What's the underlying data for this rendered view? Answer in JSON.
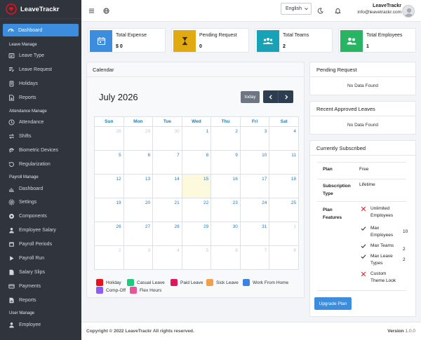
{
  "app": {
    "name": "LeaveTrackr"
  },
  "sidebar": {
    "active": {
      "label": "Dashboard",
      "icon": "dashboard-icon"
    },
    "sections": [
      {
        "title": "Leave Manage",
        "items": [
          {
            "label": "Leave Type",
            "icon": "leave-type-icon"
          },
          {
            "label": "Leave Request",
            "icon": "leave-request-icon"
          },
          {
            "label": "Holidays",
            "icon": "holidays-icon"
          },
          {
            "label": "Reports",
            "icon": "reports-icon"
          }
        ]
      },
      {
        "title": "Attendance Manage",
        "items": [
          {
            "label": "Attendance",
            "icon": "attendance-icon"
          },
          {
            "label": "Shifts",
            "icon": "shifts-icon"
          },
          {
            "label": "Biometric Devices",
            "icon": "fingerprint-icon"
          },
          {
            "label": "Regularization",
            "icon": "regularization-icon"
          }
        ]
      },
      {
        "title": "Payroll Manage",
        "items": [
          {
            "label": "Dashboard",
            "icon": "chart-icon"
          },
          {
            "label": "Settings",
            "icon": "settings-icon"
          },
          {
            "label": "Components",
            "icon": "components-icon"
          },
          {
            "label": "Employee Salary",
            "icon": "salary-icon"
          },
          {
            "label": "Payroll Periods",
            "icon": "payroll-periods-icon"
          },
          {
            "label": "Payroll Run",
            "icon": "play-icon"
          },
          {
            "label": "Salary Slips",
            "icon": "salary-slips-icon"
          },
          {
            "label": "Payments",
            "icon": "payments-icon"
          },
          {
            "label": "Reports",
            "icon": "payroll-reports-icon"
          }
        ]
      },
      {
        "title": "User Manage",
        "items": [
          {
            "label": "Employee",
            "icon": "employee-icon"
          }
        ]
      }
    ]
  },
  "topbar": {
    "language": "English",
    "user_name": "LeaveTrackr",
    "user_email": "info@leavetrackr.com"
  },
  "stats": [
    {
      "label": "Total Expense",
      "value": "$ 0",
      "color": "#3c8dde",
      "icon": "calendar-icon"
    },
    {
      "label": "Pending Request",
      "value": "0",
      "color": "#e0aa10",
      "icon": "hourglass-icon"
    },
    {
      "label": "Total Teams",
      "value": "2",
      "color": "#17a2b8",
      "icon": "team-icon"
    },
    {
      "label": "Total Employees",
      "value": "1",
      "color": "#28b463",
      "icon": "employees-icon"
    }
  ],
  "calendar": {
    "heading": "Calendar",
    "month_title": "July 2026",
    "today_label": "today",
    "weekdays": [
      "Sun",
      "Mon",
      "Tue",
      "Wed",
      "Thu",
      "Fri",
      "Sat"
    ],
    "weeks": [
      [
        "28",
        "29",
        "30",
        "1",
        "2",
        "3",
        "4"
      ],
      [
        "5",
        "6",
        "7",
        "8",
        "9",
        "10",
        "11"
      ],
      [
        "12",
        "13",
        "14",
        "15",
        "16",
        "17",
        "18"
      ],
      [
        "19",
        "20",
        "21",
        "22",
        "23",
        "24",
        "25"
      ],
      [
        "26",
        "27",
        "28",
        "29",
        "30",
        "31",
        "1"
      ],
      [
        "2",
        "3",
        "4",
        "5",
        "6",
        "7",
        "8"
      ]
    ],
    "legend": [
      {
        "label": "Holiday",
        "color": "#e8101c"
      },
      {
        "label": "Casual Leave",
        "color": "#1ec97a"
      },
      {
        "label": "Paid Leave",
        "color": "#e0155a"
      },
      {
        "label": "Sick Leave",
        "color": "#f0a04a"
      },
      {
        "label": "Work From Home",
        "color": "#3b82e6"
      },
      {
        "label": "Comp-Off",
        "color": "#8b5cf6"
      },
      {
        "label": "Flex Hours",
        "color": "#e8559a"
      }
    ]
  },
  "pending_panel": {
    "title": "Pending Request",
    "empty": "No Data Found"
  },
  "approved_panel": {
    "title": "Recent Approved Leaves",
    "empty": "No Data Found"
  },
  "subscription": {
    "title": "Currently Subscribed",
    "plan_label": "Plan",
    "plan_value": "Free",
    "type_label": "Subscription Type",
    "type_value": "Lifetime",
    "features_label": "Plan Features",
    "features": [
      {
        "name": "Unlimited Employees",
        "value": "",
        "included": false
      },
      {
        "name": "Max Employees",
        "value": "10",
        "included": true
      },
      {
        "name": "Max Teams",
        "value": "2",
        "included": true
      },
      {
        "name": "Max Leave Types",
        "value": "2",
        "included": true
      },
      {
        "name": "Custom Theme Look",
        "value": "",
        "included": false
      }
    ],
    "upgrade_label": "Upgrade Plan"
  },
  "footer": {
    "copyright": "Copyright © 2022 LeaveTrackr All rights reserved.",
    "version_label": "Version",
    "version_value": "1.0.0"
  }
}
